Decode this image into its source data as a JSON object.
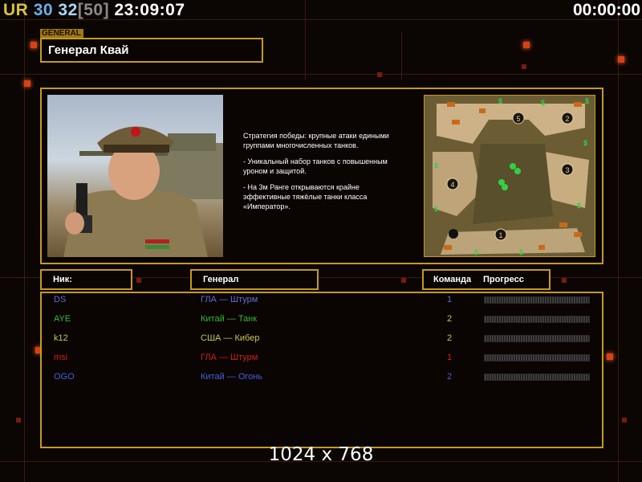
{
  "hud": {
    "ur": "UR",
    "count_a": "30",
    "count_b": "32",
    "bracket_open": "[",
    "limit": "50",
    "bracket_close": "]",
    "clock": "23:09:07",
    "timer": "00:00:00"
  },
  "general": {
    "tag": "GENERAL",
    "name": "Генерал Квай"
  },
  "description": [
    "Стратегия победы: крупные атаки едиными\nгруппами многочисленных танков.",
    "- Уникальный набор танков с повышенным\nуроном и защитой.",
    "- На 3м Ранге открываются крайне\nэффективные тяжёлые танки класса\n«Император»."
  ],
  "minimap": {
    "slots": [
      "5",
      "2",
      "3",
      "4",
      "1"
    ],
    "supply_symbol": "$"
  },
  "table": {
    "headers": {
      "nick": "Ник:",
      "general": "Генерал",
      "team": "Команда",
      "progress": "Прогресс"
    },
    "rows": [
      {
        "nick": "DS",
        "general": "ГЛА — Штурм",
        "team": "1",
        "color": "#5b6fd8"
      },
      {
        "nick": "AYE",
        "general": "Китай — Танк",
        "team": "2",
        "color": "#36b93a"
      },
      {
        "nick": "k12",
        "general": "США — Кибер",
        "team": "2",
        "color": "#c8c85a"
      },
      {
        "nick": "msi",
        "general": "ГЛА — Штурм",
        "team": "1",
        "color": "#d0201a"
      },
      {
        "nick": "OGO",
        "general": "Китай — Огонь",
        "team": "2",
        "color": "#4a5fe0"
      }
    ]
  },
  "resolution": "1024 x 768",
  "colors": {
    "gold": "#c69a1e",
    "ur": "#d8c23a",
    "count_a": "#6ab0e8",
    "count_b": "#a8d8f8",
    "limit": "#8a8a8a"
  }
}
